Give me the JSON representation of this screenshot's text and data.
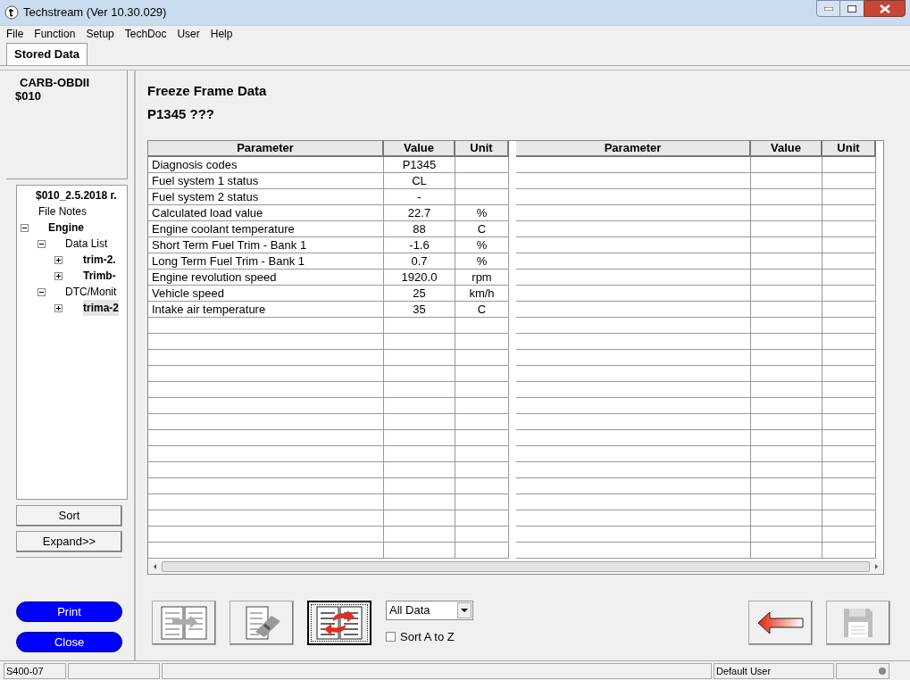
{
  "window": {
    "title": "Techstream (Ver 10.30.029)"
  },
  "menu": [
    "File",
    "Function",
    "Setup",
    "TechDoc",
    "User",
    "Help"
  ],
  "tabs": [
    {
      "label": "Stored Data",
      "selected": true
    }
  ],
  "sidebar": {
    "header": [
      "CARB-OBDII",
      "$010"
    ],
    "tree": [
      {
        "label": "$010_2.5.2018 г.",
        "bold": true,
        "selected": false,
        "children": [
          {
            "label": "File Notes",
            "bold": false,
            "selected": false
          },
          {
            "label": "Engine",
            "bold": true,
            "selected": false,
            "expanded": true,
            "children": [
              {
                "label": "Data List",
                "bold": false,
                "selected": false,
                "expanded": true,
                "children": [
                  {
                    "label": "trim-2.",
                    "bold": true,
                    "selected": false,
                    "expanded": false
                  },
                  {
                    "label": "Trimb-",
                    "bold": true,
                    "selected": false,
                    "expanded": false
                  }
                ]
              },
              {
                "label": "DTC/Monit",
                "bold": false,
                "selected": false,
                "expanded": true,
                "children": [
                  {
                    "label": "trima-2",
                    "bold": true,
                    "selected": true,
                    "expanded": false
                  }
                ]
              }
            ]
          }
        ]
      }
    ],
    "buttons": [
      {
        "label": "Sort",
        "kind": "plain"
      },
      {
        "label": "Expand>>",
        "kind": "plain"
      },
      {
        "label": "Print",
        "kind": "pill"
      },
      {
        "label": "Close",
        "kind": "pill"
      }
    ]
  },
  "content": {
    "title": "Freeze Frame Data",
    "subtitle": "P1345 ???",
    "grids": [
      {
        "columns": [
          "Parameter",
          "Value",
          "Unit"
        ],
        "rows": [
          [
            "Diagnosis codes",
            "P1345",
            ""
          ],
          [
            "Fuel system 1 status",
            "CL",
            ""
          ],
          [
            "Fuel system 2 status",
            "-",
            ""
          ],
          [
            "Calculated load value",
            "22.7",
            "%"
          ],
          [
            "Engine coolant temperature",
            "88",
            "C"
          ],
          [
            "Short Term Fuel Trim - Bank 1",
            "-1.6",
            "%"
          ],
          [
            "Long Term Fuel Trim - Bank 1",
            "0.7",
            "%"
          ],
          [
            "Engine revolution speed",
            "1920.0",
            "rpm"
          ],
          [
            "Vehicle speed",
            "25",
            "km/h"
          ],
          [
            "Intake air temperature",
            "35",
            "C"
          ]
        ]
      },
      {
        "columns": [
          "Parameter",
          "Value",
          "Unit"
        ]
      }
    ]
  },
  "toolbar": {
    "tools": [
      {
        "kind": "copy",
        "selected": false
      },
      {
        "kind": "erase",
        "selected": false
      },
      {
        "kind": "swap",
        "selected": true
      }
    ],
    "filter": {
      "value": "All Data"
    },
    "sort": {
      "label": "Sort A to Z",
      "checked": false
    },
    "back": {
      "disabled": false
    },
    "save": {
      "disabled": true
    }
  },
  "status_bar": {
    "code": "S400-07",
    "user": "Default User"
  }
}
